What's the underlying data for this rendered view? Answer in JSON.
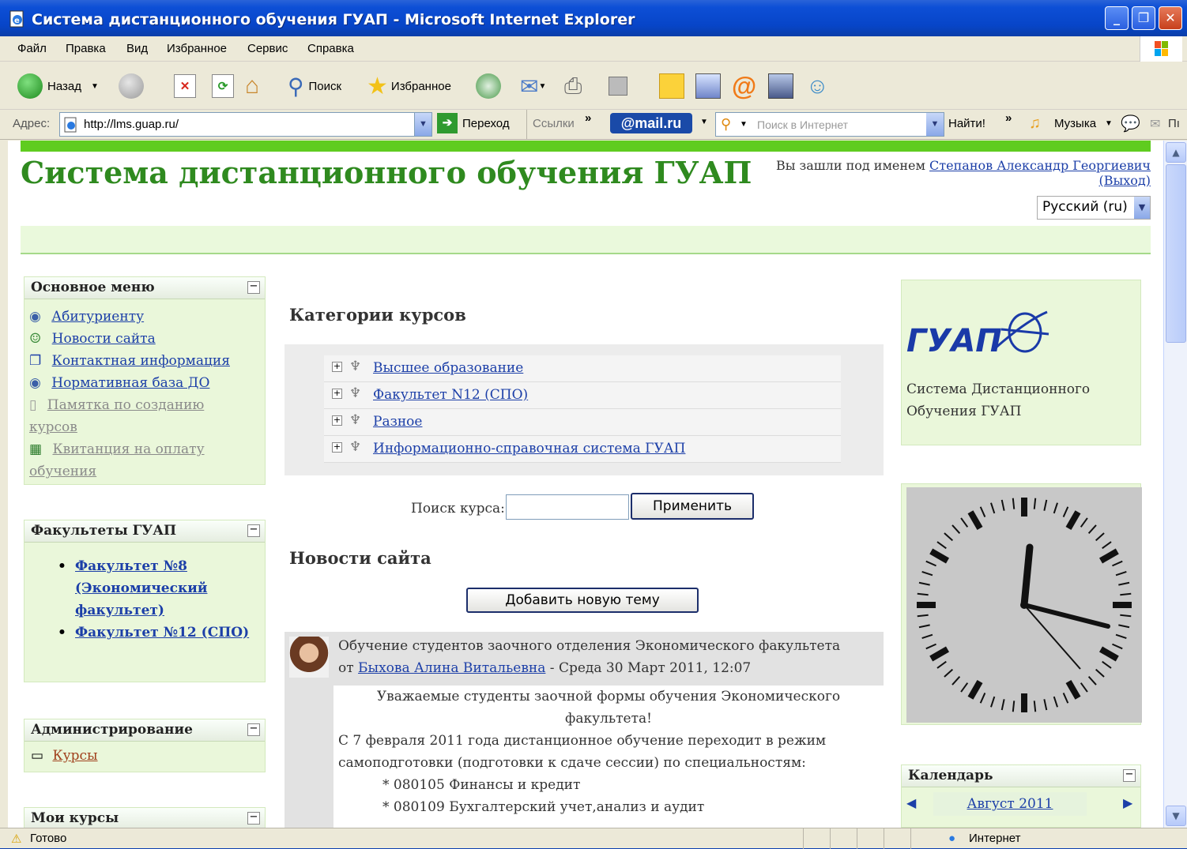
{
  "window": {
    "title": "Система дистанционного обучения ГУАП - Microsoft Internet Explorer"
  },
  "menubar": [
    "Файл",
    "Правка",
    "Вид",
    "Избранное",
    "Сервис",
    "Справка"
  ],
  "toolbar": {
    "back": "Назад",
    "search": "Поиск",
    "favorites": "Избранное"
  },
  "addressbar": {
    "label": "Адрес:",
    "url": "http://lms.guap.ru/",
    "go": "Переход",
    "links": "Ссылки",
    "mailru": "@mail.ru",
    "search_placeholder": "Поиск в Интернет",
    "find": "Найти!",
    "music": "Музыка",
    "more": "Пı"
  },
  "page": {
    "site_title": "Система дистанционного обучения ГУАП",
    "logged_in_prefix": "Вы зашли под именем ",
    "user_name": "Степанов Александр Георгиевич",
    "logout": "(Выход)",
    "language": "Русский (ru)"
  },
  "left": {
    "main_menu": {
      "title": "Основное меню",
      "items": [
        {
          "label": "Абитуриенту"
        },
        {
          "label": "Новости сайта"
        },
        {
          "label": "Контактная информация"
        },
        {
          "label": "Нормативная база ДО"
        },
        {
          "label": "Памятка по созданию",
          "cont": "курсов"
        },
        {
          "label": "Квитанция на оплату",
          "cont": "обучения"
        }
      ]
    },
    "faculties": {
      "title": "Факультеты ГУАП",
      "items": [
        {
          "l1": "Факультет №8",
          "l2": "(Экономический",
          "l3": "факультет)"
        },
        {
          "l1": "Факультет №12 (СПО)"
        }
      ]
    },
    "admin": {
      "title": "Администрирование",
      "courses": "Курсы"
    },
    "my_courses": {
      "title": "Мои курсы"
    }
  },
  "center": {
    "categories_title": "Категории курсов",
    "categories": [
      "Высшее образование",
      "Факультет N12 (СПО)",
      "Разное",
      "Информационно-справочная система ГУАП"
    ],
    "search_label": "Поиск курса:",
    "apply": "Применить",
    "news_title": "Новости сайта",
    "add_topic": "Добавить новую тему",
    "post": {
      "subject": "Обучение студентов заочного отделения Экономического факультета",
      "by": "от ",
      "author": "Быхова Алина Витальевна",
      "date": " - Среда 30 Март 2011, 12:07",
      "body1": "Уважаемые студенты заочной формы обучения Экономического",
      "body2": "факультета!",
      "body3": "С 7 февраля 2011 года дистанционное обучение переходит в режим",
      "body4": "самоподготовки (подготовки к сдаче сессии) по специальностям:",
      "body5": "* 080105 Финансы и кредит",
      "body6": "* 080109 Бухгалтерский учет,анализ и аудит"
    }
  },
  "right": {
    "logo_text": "ГУАП",
    "description1": "Система Дистанционного",
    "description2": "Обучения ГУАП",
    "calendar_title": "Календарь",
    "month": "Август 2011"
  },
  "status": {
    "text": "Готово",
    "zone": "Интернет"
  }
}
